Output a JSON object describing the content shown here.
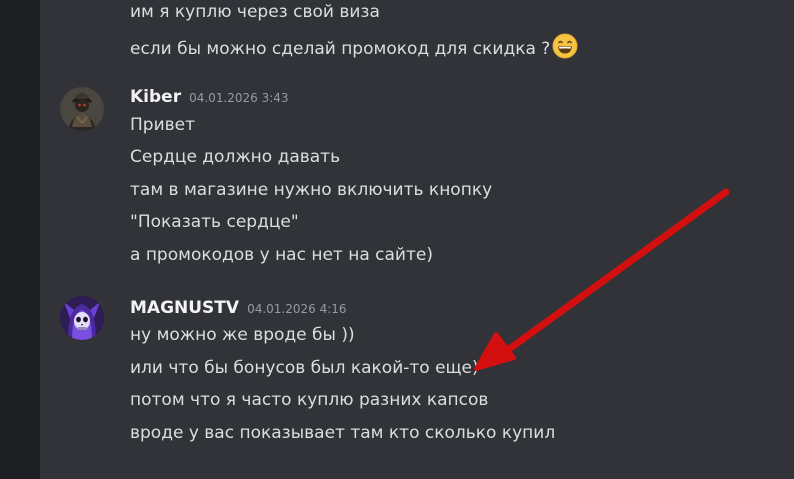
{
  "colors": {
    "background": "#313338",
    "left_strip": "#1e1f22",
    "text": "#dbdee1",
    "username": "#f2f3f5",
    "timestamp": "#949ba4",
    "arrow": "#d30f0f"
  },
  "previous_messages": [
    "им я куплю через свой виза",
    "если бы можно сделай промокод для скидка ?"
  ],
  "previous_emoji": "grinning-face-icon",
  "messages": [
    {
      "username": "Kiber",
      "timestamp": "04.01.2026 3:43",
      "avatar": "dark-hooded-figure-avatar",
      "lines": [
        "Привет",
        "Сердце должно давать",
        "там в магазине нужно включить кнопку",
        "\"Показать сердце\"",
        "а промокодов у нас нет на сайте)"
      ]
    },
    {
      "username": "MAGNUSTV",
      "timestamp": "04.01.2026 4:16",
      "avatar": "purple-skull-wolf-avatar",
      "lines": [
        "ну можно же вроде бы ))",
        "или что бы бонусов был какой-то еще)",
        "потом что я часто куплю разних капсов",
        "вроде у вас показывает там кто сколько купил"
      ]
    }
  ]
}
